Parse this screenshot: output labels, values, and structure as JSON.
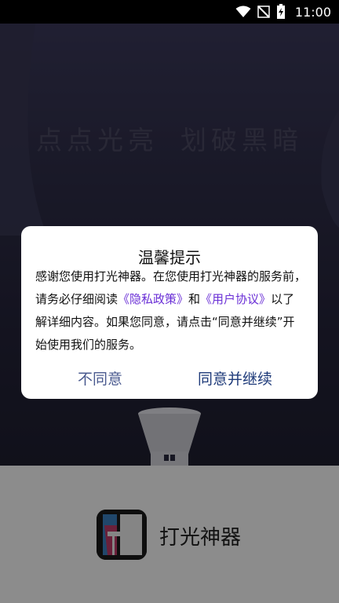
{
  "status_bar": {
    "time": "11:00",
    "icons": [
      "wifi-icon",
      "signal-off-icon",
      "battery-charging-icon"
    ]
  },
  "splash": {
    "slogan_part1": "点点光亮",
    "slogan_part2": "划破黑暗"
  },
  "dialog": {
    "title": "温馨提示",
    "body_text_1": "感谢您使用打光神器。在您使用打光神器的服务前，请务必仔细阅读",
    "privacy_link": "《隐私政策》",
    "body_and": "和",
    "agreement_link": "《用户协议》",
    "body_text_2": "以了解详细内容。如果您同意，请点击“同意并继续”开始使用我们的服务。",
    "disagree_label": "不同意",
    "agree_label": "同意并继续",
    "link_color": "#6a2fd6"
  },
  "brand": {
    "app_name": "打光神器",
    "logo_icon": "lamp-logo-icon"
  }
}
